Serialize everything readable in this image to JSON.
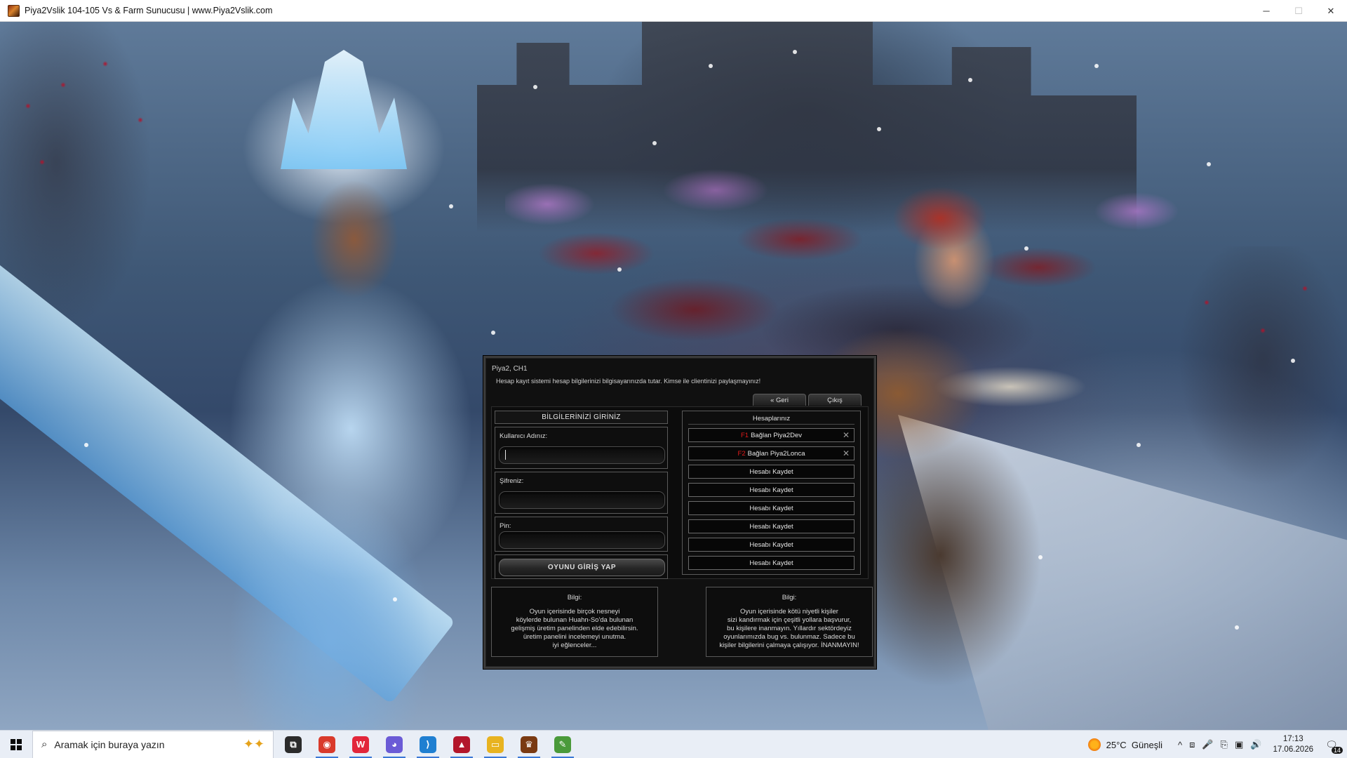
{
  "window": {
    "title": "Piya2Vslik 104-105 Vs & Farm Sunucusu | www.Piya2Vslik.com",
    "controls": {
      "minimize": "─",
      "maximize": "☐",
      "close": "✕"
    }
  },
  "dialog": {
    "title": "Piya2, CH1",
    "notice": "Hesap kayıt sistemi hesap bilgilerinizi bilgisayarınızda tutar. Kimse ile clientinizi paylaşmayınız!",
    "tabs": {
      "back": "« Geri",
      "exit": "Çıkış"
    },
    "login": {
      "header": "BİLGİLERİNİZİ GİRİNİZ",
      "username_label": "Kullanıcı Adınız:",
      "username_value": "",
      "password_label": "Şifreniz:",
      "password_value": "",
      "pin_label": "Pin:",
      "pin_value": "",
      "submit": "OYUNU GİRİŞ YAP"
    },
    "accounts": {
      "header": "Hesaplarınız",
      "items": [
        {
          "key": "F1",
          "label": "Bağlan Piya2Dev",
          "removable": true
        },
        {
          "key": "F2",
          "label": "Bağlan Piya2Lonca",
          "removable": true
        },
        {
          "key": "",
          "label": "Hesabı Kaydet",
          "removable": false
        },
        {
          "key": "",
          "label": "Hesabı Kaydet",
          "removable": false
        },
        {
          "key": "",
          "label": "Hesabı Kaydet",
          "removable": false
        },
        {
          "key": "",
          "label": "Hesabı Kaydet",
          "removable": false
        },
        {
          "key": "",
          "label": "Hesabı Kaydet",
          "removable": false
        },
        {
          "key": "",
          "label": "Hesabı Kaydet",
          "removable": false
        }
      ],
      "remove_glyph": "✕"
    },
    "info_left": {
      "title": "Bilgi:",
      "lines": [
        "Oyun içerisinde birçok nesneyi",
        "köylerde bulunan Huahn-So'da bulunan",
        "gelişmiş üretim panelinden elde edebilirsin.",
        "üretim panelini incelemeyi unutma.",
        "iyi eğlenceler..."
      ]
    },
    "info_right": {
      "title": "Bilgi:",
      "lines": [
        "Oyun içerisinde kötü niyetli kişiler",
        "sizi kandırmak için çeşitli yollara başvurur,",
        "bu kişilere inanmayın. Yıllardır sektördeyiz",
        "oyunlarımızda bug vs. bulunmaz. Sadece bu",
        "kişiler bilgilerini çalmaya çalışıyor. İNANMAYIN!"
      ]
    }
  },
  "taskbar": {
    "search_placeholder": "Aramak için buraya yazın",
    "search_icon": "search-icon",
    "apps": [
      {
        "name": "task-view",
        "glyph": "⧉",
        "color": "#2b2b2b"
      },
      {
        "name": "chrome",
        "glyph": "◉",
        "color": "#d93a2b"
      },
      {
        "name": "wps-office",
        "glyph": "W",
        "color": "#e2263a"
      },
      {
        "name": "discord",
        "glyph": "◕",
        "color": "#6b5bd6"
      },
      {
        "name": "visual-studio-code",
        "glyph": "⟩",
        "color": "#1f7fd1"
      },
      {
        "name": "red-app",
        "glyph": "▲",
        "color": "#b3162b"
      },
      {
        "name": "file-explorer",
        "glyph": "▭",
        "color": "#e8b320"
      },
      {
        "name": "game-client",
        "glyph": "♛",
        "color": "#7a3a12"
      },
      {
        "name": "notepad-app",
        "glyph": "✎",
        "color": "#4a9a3a"
      }
    ],
    "weather": {
      "temp": "25°C",
      "condition": "Güneşli"
    },
    "tray_icons": [
      "^",
      "⧈",
      "🎤",
      "⎘",
      "▣",
      "🔊"
    ],
    "time": "17:13",
    "date": "17.06.2026",
    "notification_count": "14"
  }
}
